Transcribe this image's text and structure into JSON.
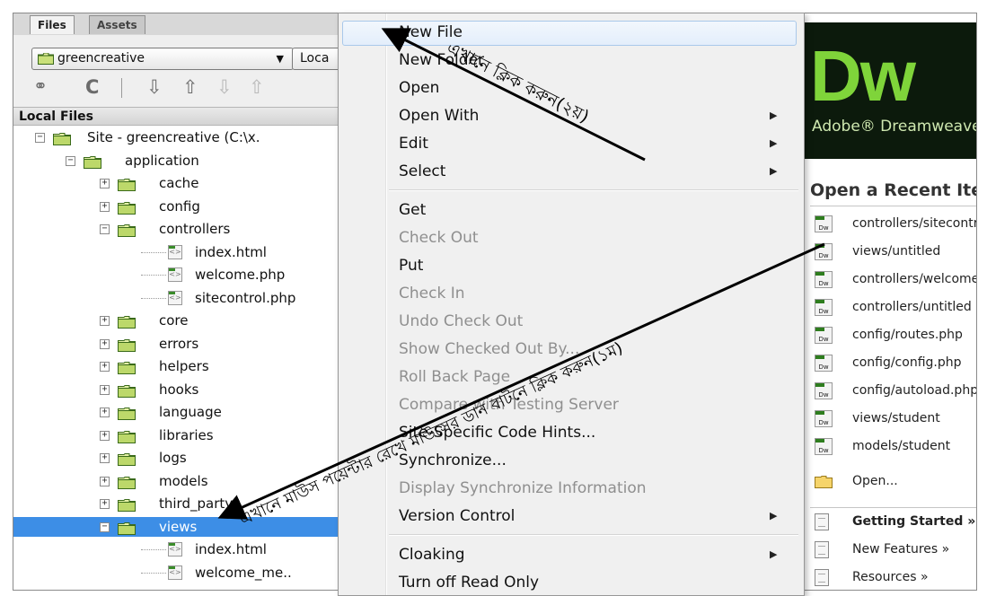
{
  "files_panel": {
    "tabs": [
      "Files",
      "Assets"
    ],
    "site_select": "greencreative",
    "view_select": "Loca",
    "toolbar_icons": [
      "connect-icon",
      "refresh-icon",
      "get-icon",
      "put-icon",
      "check-out-icon",
      "check-in-icon"
    ],
    "header": "Local Files",
    "tree": [
      {
        "label": "Site - greencreative (C:\\x.",
        "type": "site",
        "toggle": "−"
      },
      {
        "label": "application",
        "type": "folder",
        "toggle": "−"
      },
      {
        "label": "cache",
        "type": "folder",
        "toggle": "+"
      },
      {
        "label": "config",
        "type": "folder",
        "toggle": "+"
      },
      {
        "label": "controllers",
        "type": "folder",
        "toggle": "−"
      },
      {
        "label": "index.html",
        "type": "file"
      },
      {
        "label": "welcome.php",
        "type": "file"
      },
      {
        "label": "sitecontrol.php",
        "type": "file"
      },
      {
        "label": "core",
        "type": "folder",
        "toggle": "+"
      },
      {
        "label": "errors",
        "type": "folder",
        "toggle": "+"
      },
      {
        "label": "helpers",
        "type": "folder",
        "toggle": "+"
      },
      {
        "label": "hooks",
        "type": "folder",
        "toggle": "+"
      },
      {
        "label": "language",
        "type": "folder",
        "toggle": "+"
      },
      {
        "label": "libraries",
        "type": "folder",
        "toggle": "+"
      },
      {
        "label": "logs",
        "type": "folder",
        "toggle": "+"
      },
      {
        "label": "models",
        "type": "folder",
        "toggle": "+"
      },
      {
        "label": "third_party",
        "type": "folder",
        "toggle": "+"
      },
      {
        "label": "views",
        "type": "folder",
        "toggle": "−",
        "selected": true
      },
      {
        "label": "index.html",
        "type": "file"
      },
      {
        "label": "welcome_me..",
        "type": "file"
      }
    ]
  },
  "context_menu": {
    "items": [
      {
        "label": "New File",
        "disabled": false,
        "submenu": false,
        "hover": true
      },
      {
        "label": "New Folder",
        "disabled": false,
        "submenu": false
      },
      {
        "label": "Open",
        "disabled": false,
        "submenu": false
      },
      {
        "label": "Open With",
        "disabled": false,
        "submenu": true
      },
      {
        "label": "Edit",
        "disabled": false,
        "submenu": true
      },
      {
        "label": "Select",
        "disabled": false,
        "submenu": true,
        "sep_after": true
      },
      {
        "label": "Get",
        "disabled": false,
        "submenu": false
      },
      {
        "label": "Check Out",
        "disabled": true,
        "submenu": false
      },
      {
        "label": "Put",
        "disabled": false,
        "submenu": false
      },
      {
        "label": "Check In",
        "disabled": true,
        "submenu": false
      },
      {
        "label": "Undo Check Out",
        "disabled": true,
        "submenu": false
      },
      {
        "label": "Show Checked Out By...",
        "disabled": true,
        "submenu": false
      },
      {
        "label": "Roll Back Page",
        "disabled": true,
        "submenu": false
      },
      {
        "label": "Compare with Testing Server",
        "disabled": true,
        "submenu": false
      },
      {
        "label": "Site-Specific Code Hints...",
        "disabled": false,
        "submenu": false
      },
      {
        "label": "Synchronize...",
        "disabled": false,
        "submenu": false
      },
      {
        "label": "Display Synchronize Information",
        "disabled": true,
        "submenu": false
      },
      {
        "label": "Version Control",
        "disabled": false,
        "submenu": true,
        "sep_after": true
      },
      {
        "label": "Cloaking",
        "disabled": false,
        "submenu": true
      },
      {
        "label": "Turn off Read Only",
        "disabled": false,
        "submenu": false
      }
    ]
  },
  "start_page": {
    "logo": "Dw",
    "product": "Adobe® Dreamweaver",
    "recent_title": "Open a Recent Item",
    "recent_items": [
      "controllers/sitecontrol.php",
      "views/untitled",
      "controllers/welcome.php",
      "controllers/untitled",
      "config/routes.php",
      "config/config.php",
      "config/autoload.php",
      "views/student",
      "models/student"
    ],
    "open_label": "Open...",
    "docs": [
      {
        "label": "Getting Started »",
        "bold": true
      },
      {
        "label": "New Features »",
        "bold": false
      },
      {
        "label": "Resources »",
        "bold": false
      }
    ]
  },
  "annotations": {
    "step2": "এখানে ক্লিক করুন(২য়)",
    "step1": "এখানে মাউস পয়েন্টার রেখে মাউসের ডান বাটনে ক্লিক করুন(১ম)"
  }
}
